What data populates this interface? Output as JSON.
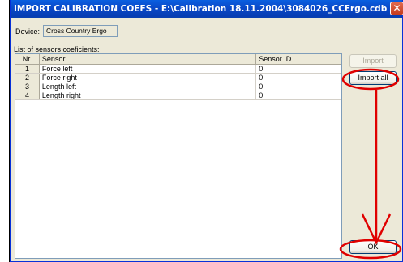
{
  "window": {
    "title": "IMPORT CALIBRATION COEFS - E:\\Calibration 18.11.2004\\3084026_CCErgo.cdb",
    "close_glyph": "✕"
  },
  "device": {
    "label": "Device:",
    "value": "Cross Country Ergo"
  },
  "list_label": "List of sensors coeficients:",
  "table": {
    "columns": [
      "Nr.",
      "Sensor",
      "Sensor ID"
    ],
    "rows": [
      {
        "nr": "1",
        "sensor": "Force left",
        "id": "0"
      },
      {
        "nr": "2",
        "sensor": "Force right",
        "id": "0"
      },
      {
        "nr": "3",
        "sensor": "Length left",
        "id": "0"
      },
      {
        "nr": "4",
        "sensor": "Length right",
        "id": "0"
      }
    ]
  },
  "buttons": {
    "import": "Import",
    "import_all": "Import all",
    "ok": "OK"
  },
  "annotation_color": "#e00000"
}
